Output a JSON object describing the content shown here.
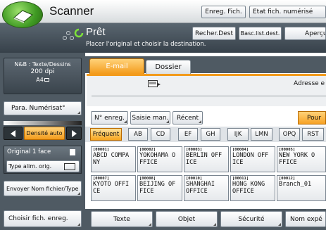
{
  "app": {
    "title": "Scanner"
  },
  "header": {
    "reg_prog_label": "Enreg. Fich.",
    "file_status_label": "Etat fich. numérisé"
  },
  "status": {
    "title": "Prêt",
    "subtitle": "Placer l'original et choisir la destination."
  },
  "toolbar": {
    "search_dest": "Recher.Dest",
    "switch_list": "Basc.list.dest.",
    "preview": "Aperçu"
  },
  "left": {
    "mode_line1": "N&B : Texte/Dessins",
    "mode_line2": "200 dpi",
    "mode_line3": "A4",
    "scan_settings": "Para. Numérisat°",
    "density_label": "Densité auto",
    "original_label": "Original 1 face",
    "orig_type": "Type alim. orig.",
    "send_file_type": "Envoyer Nom fichier/Type",
    "select_file": "Choisir fich. enreg."
  },
  "tabs": [
    {
      "label": "E-mail"
    },
    {
      "label": "Dossier"
    }
  ],
  "dest": {
    "address_label": "Adresse e"
  },
  "actions": {
    "manual_reg": "N° enreg.",
    "manual_input": "Saisie man.",
    "recent": "Récent",
    "send_to": "Pour"
  },
  "index_tabs": [
    "Fréquent",
    "AB",
    "CD",
    "EF",
    "GH",
    "IJK",
    "LMN",
    "OPQ",
    "RST"
  ],
  "destinations": [
    {
      "num": "[00001]",
      "line1": "ABCD COMPA",
      "line2": "NY"
    },
    {
      "num": "[00002]",
      "line1": "YOKOHAMA O",
      "line2": "FFICE"
    },
    {
      "num": "[00003]",
      "line1": "BERLIN OFF",
      "line2": "ICE"
    },
    {
      "num": "[00004]",
      "line1": "LONDON OFF",
      "line2": "ICE"
    },
    {
      "num": "[00005]",
      "line1": "NEW YORK O",
      "line2": "FFICE"
    },
    {
      "num": "[00007]",
      "line1": "KYOTO OFFI",
      "line2": "CE"
    },
    {
      "num": "[00008]",
      "line1": "BEIJING OF",
      "line2": "FICE"
    },
    {
      "num": "[00010]",
      "line1": "SHANGHAI",
      "line2": "OFFICE"
    },
    {
      "num": "[00011]",
      "line1": "HONG KONG",
      "line2": "OFFICE"
    },
    {
      "num": "[00012]",
      "line1": "Branch_01",
      "line2": ""
    }
  ],
  "bottom": {
    "text": "Texte",
    "subject": "Objet",
    "security": "Sécurité",
    "sender": "Nom expé"
  }
}
